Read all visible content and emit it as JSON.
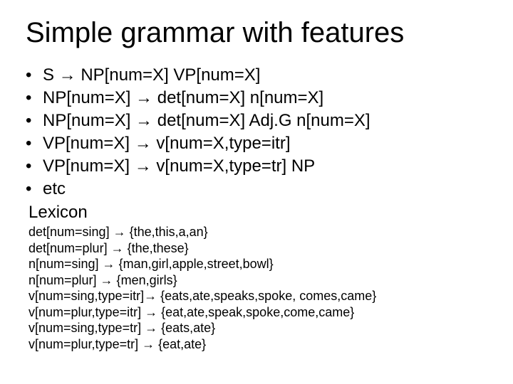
{
  "title": "Simple grammar with features",
  "rules": [
    "S → NP[num=X] VP[num=X]",
    "NP[num=X] → det[num=X] n[num=X]",
    "NP[num=X] → det[num=X] Adj.G n[num=X]",
    "VP[num=X] → v[num=X,type=itr]",
    "VP[num=X] → v[num=X,type=tr] NP",
    "etc"
  ],
  "lexicon_label": "Lexicon",
  "lexicon": [
    "det[num=sing] → {the,this,a,an}",
    "det[num=plur] → {the,these}",
    "n[num=sing] → {man,girl,apple,street,bowl}",
    "n[num=plur] → {men,girls}",
    "v[num=sing,type=itr]→ {eats,ate,speaks,spoke, comes,came}",
    "v[num=plur,type=itr] → {eat,ate,speak,spoke,come,came}",
    "v[num=sing,type=tr] → {eats,ate}",
    "v[num=plur,type=tr] → {eat,ate}"
  ]
}
